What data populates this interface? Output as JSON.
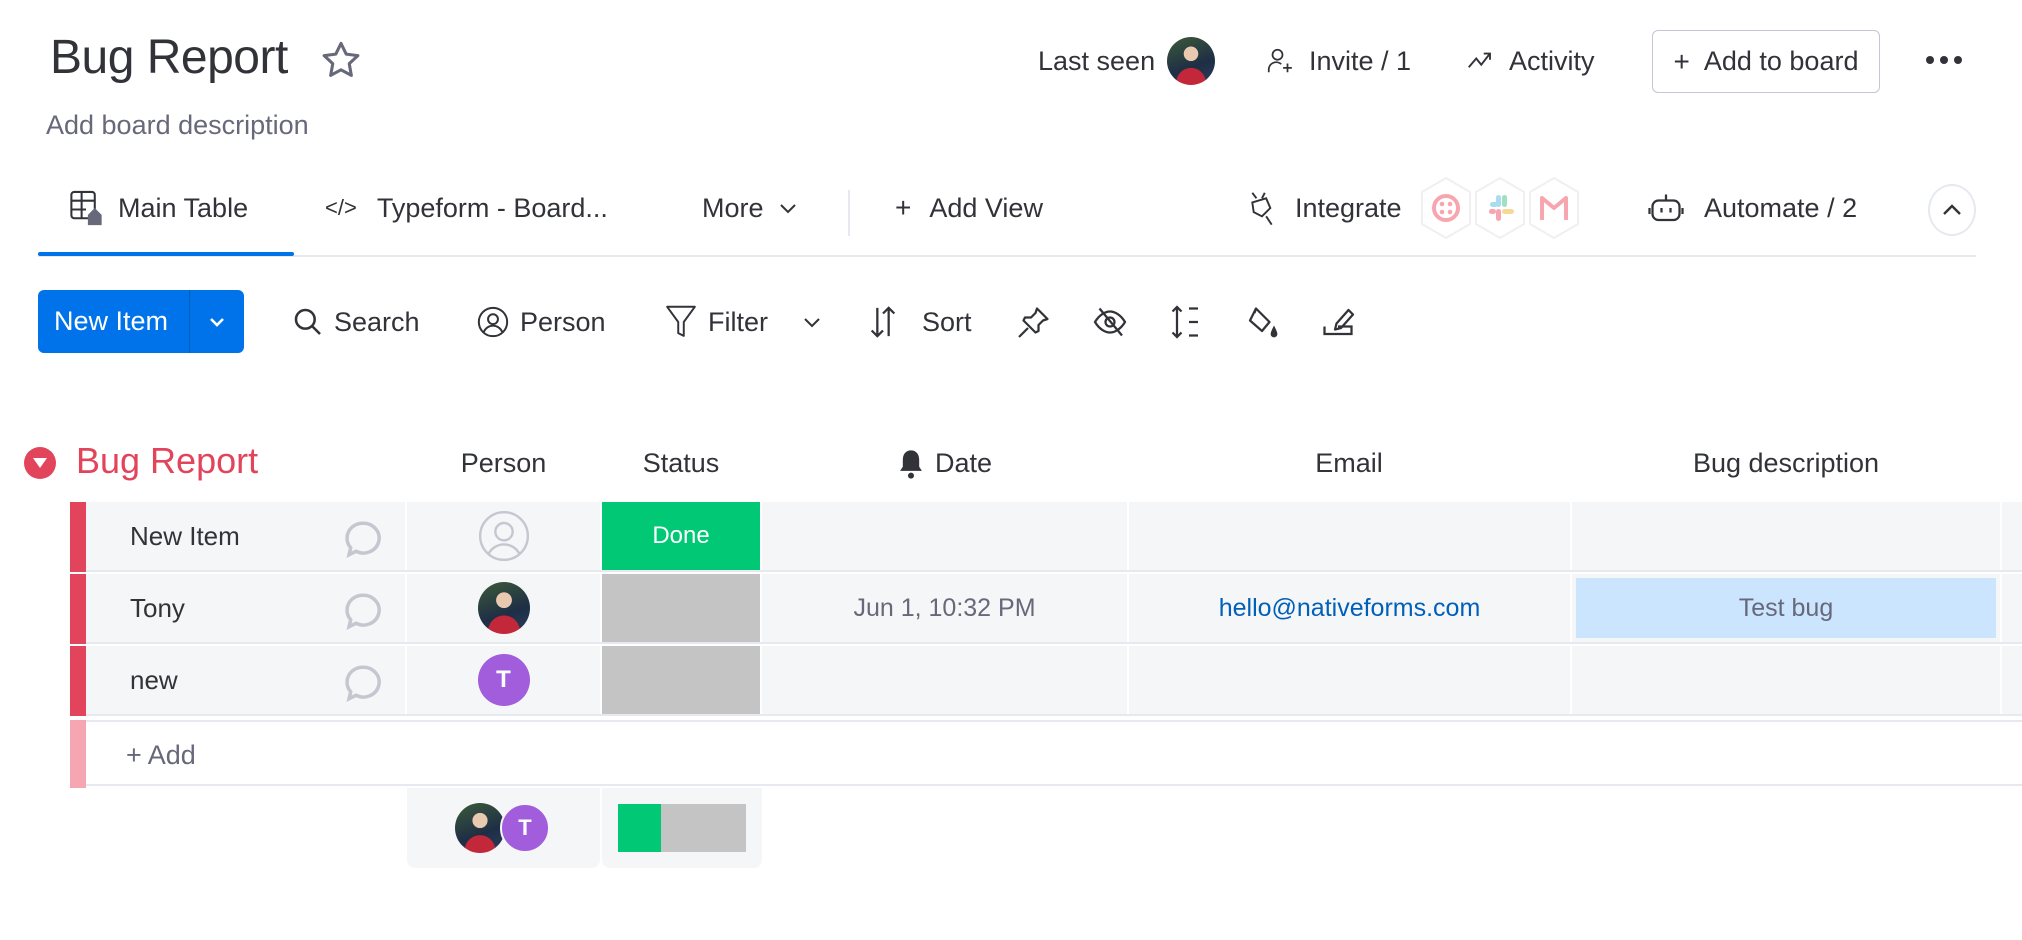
{
  "header": {
    "title": "Bug Report",
    "description": "Add board description",
    "last_seen_label": "Last seen",
    "invite_label": "Invite / 1",
    "activity_label": "Activity",
    "add_to_board_label": "Add to board"
  },
  "tabs": {
    "main_table": "Main Table",
    "typeform": "Typeform - Board...",
    "more": "More",
    "add_view": "Add View",
    "integrate": "Integrate",
    "automate": "Automate / 2"
  },
  "toolbar": {
    "new_item": "New Item",
    "search": "Search",
    "person": "Person",
    "filter": "Filter",
    "sort": "Sort"
  },
  "group": {
    "title": "Bug Report",
    "color": "#e2445c",
    "columns": {
      "person": "Person",
      "status": "Status",
      "date": "Date",
      "email": "Email",
      "bug_description": "Bug description"
    },
    "rows": [
      {
        "name": "New Item",
        "person": "",
        "status": "Done",
        "date": "",
        "email": "",
        "bug_description": ""
      },
      {
        "name": "Tony",
        "person": "photo",
        "status": "",
        "date": "Jun 1, 10:32 PM",
        "email": "hello@nativeforms.com",
        "bug_description": "Test bug"
      },
      {
        "name": "new",
        "person": "T",
        "status": "",
        "date": "",
        "email": "",
        "bug_description": ""
      }
    ],
    "add_label": "+ Add",
    "summary": {
      "person_initial": "T",
      "status_done_fraction": 0.333
    }
  },
  "colors": {
    "primary": "#0073ea",
    "done": "#00c875",
    "empty_status": "#c4c4c4",
    "avatar_purple": "#a25ddc"
  }
}
